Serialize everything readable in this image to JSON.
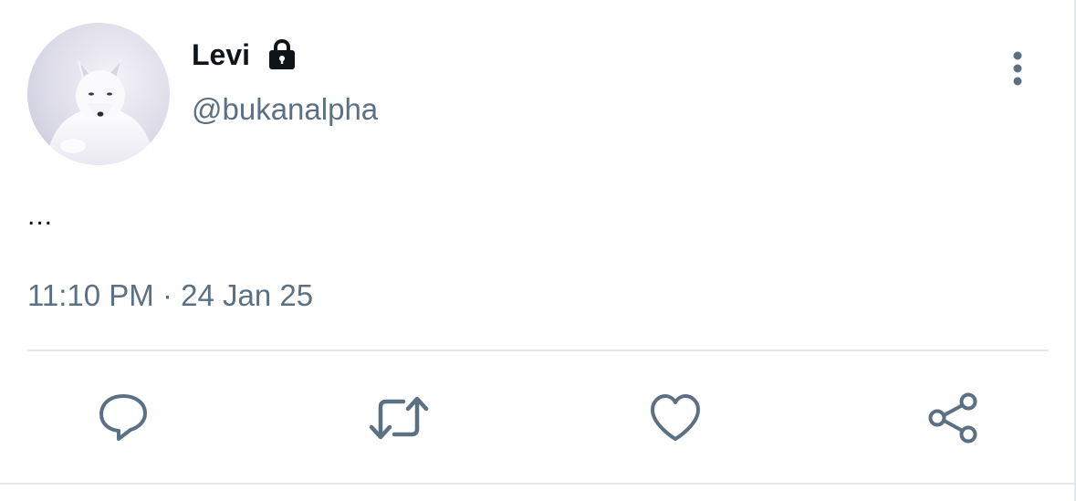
{
  "author": {
    "display_name": "Levi",
    "handle": "@bukanalpha",
    "avatar_icon": "arctic-fox-avatar",
    "protected_icon": "lock-icon"
  },
  "tweet": {
    "text": "...",
    "timestamp": "11:10 PM · 24 Jan 25"
  },
  "actions": {
    "reply_icon": "reply-icon",
    "retweet_icon": "retweet-icon",
    "like_icon": "like-icon",
    "share_icon": "share-icon"
  },
  "colors": {
    "text_primary": "#0f1419",
    "text_secondary": "#5b7083",
    "icon_gray": "#5b7083",
    "divider": "#e6e9ec"
  }
}
